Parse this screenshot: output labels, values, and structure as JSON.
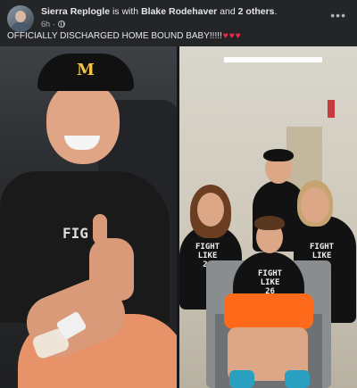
{
  "post": {
    "author": "Sierra Replogle",
    "with_text": "is with",
    "tagged_person": "Blake Rodehaver",
    "and_text": "and",
    "others": "2 others",
    "period": ".",
    "time": "6h",
    "separator": "·",
    "privacy_icon": "globe-icon",
    "more_icon": "more-options-icon",
    "caption": "OFFICIALLY DISCHARGED HOME BOUND BABY!!!!!",
    "caption_emoji": [
      "♥",
      "♥",
      "♥"
    ]
  },
  "photos": {
    "left": {
      "shirt_text": "FIG"
    },
    "right": {
      "tee_text": [
        "FIGHT\nLIKE\n26",
        "FIGHT\nLIKE\n26",
        "FIGHT\nLIKE\n26"
      ]
    }
  },
  "colors": {
    "background": "#242526",
    "text": "#e4e6eb",
    "muted": "#b0b3b8",
    "heart": "#f02849"
  }
}
